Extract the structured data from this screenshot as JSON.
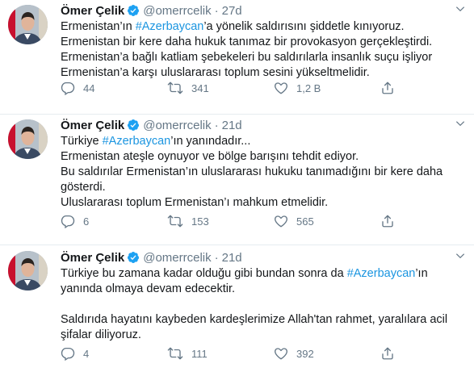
{
  "tweets": [
    {
      "name": "Ömer Çelik",
      "handle": "@omerrcelik",
      "separator": "·",
      "time": "27d",
      "lines": [
        [
          {
            "t": "Ermenistan’ın "
          },
          {
            "t": "#Azerbaycan",
            "tag": true
          },
          {
            "t": "’a yönelik saldırısını şiddetle kınıyoruz."
          }
        ],
        [
          {
            "t": "Ermenistan bir kere daha hukuk tanımaz bir provokasyon gerçekleştirdi."
          }
        ],
        [
          {
            "t": "Ermenistan’a bağlı katliam şebekeleri bu saldırılarla insanlık suçu işliyor"
          }
        ],
        [
          {
            "t": "Ermenistan’a karşı uluslararası toplum sesini yükseltmelidir."
          }
        ]
      ],
      "replies": "44",
      "retweets": "341",
      "likes": "1,2 B"
    },
    {
      "name": "Ömer Çelik",
      "handle": "@omerrcelik",
      "separator": "·",
      "time": "21d",
      "lines": [
        [
          {
            "t": "Türkiye "
          },
          {
            "t": "#Azerbaycan",
            "tag": true
          },
          {
            "t": "’ın yanındadır..."
          }
        ],
        [
          {
            "t": "Ermenistan ateşle oynuyor ve bölge barışını tehdit ediyor."
          }
        ],
        [
          {
            "t": "Bu saldırılar Ermenistan’ın uluslararası hukuku tanımadığını bir kere daha"
          }
        ],
        [
          {
            "t": "gösterdi."
          }
        ],
        [
          {
            "t": "Uluslararası toplum Ermenistan’ı mahkum etmelidir."
          }
        ]
      ],
      "replies": "6",
      "retweets": "153",
      "likes": "565"
    },
    {
      "name": "Ömer Çelik",
      "handle": "@omerrcelik",
      "separator": "·",
      "time": "21d",
      "lines": [
        [
          {
            "t": "Türkiye bu zamana kadar olduğu gibi bundan sonra da "
          },
          {
            "t": "#Azerbaycan",
            "tag": true
          },
          {
            "t": "’ın"
          }
        ],
        [
          {
            "t": "yanında olmaya devam edecektir."
          }
        ],
        [
          {
            "t": ""
          }
        ],
        [
          {
            "t": "Saldırıda hayatını kaybeden kardeşlerimize Allah'tan rahmet, yaralılara acil"
          }
        ],
        [
          {
            "t": "şifalar diliyoruz."
          }
        ]
      ],
      "replies": "4",
      "retweets": "111",
      "likes": "392"
    }
  ],
  "colors": {
    "accent": "#1da1f2",
    "hashtag": "#1b95e0",
    "secondary_text": "#657786",
    "divider": "#e6ecf0"
  },
  "icons": {
    "verified": "verified-badge-icon",
    "caret": "chevron-down-icon",
    "reply": "reply-icon",
    "retweet": "retweet-icon",
    "like": "heart-icon",
    "share": "share-icon"
  }
}
